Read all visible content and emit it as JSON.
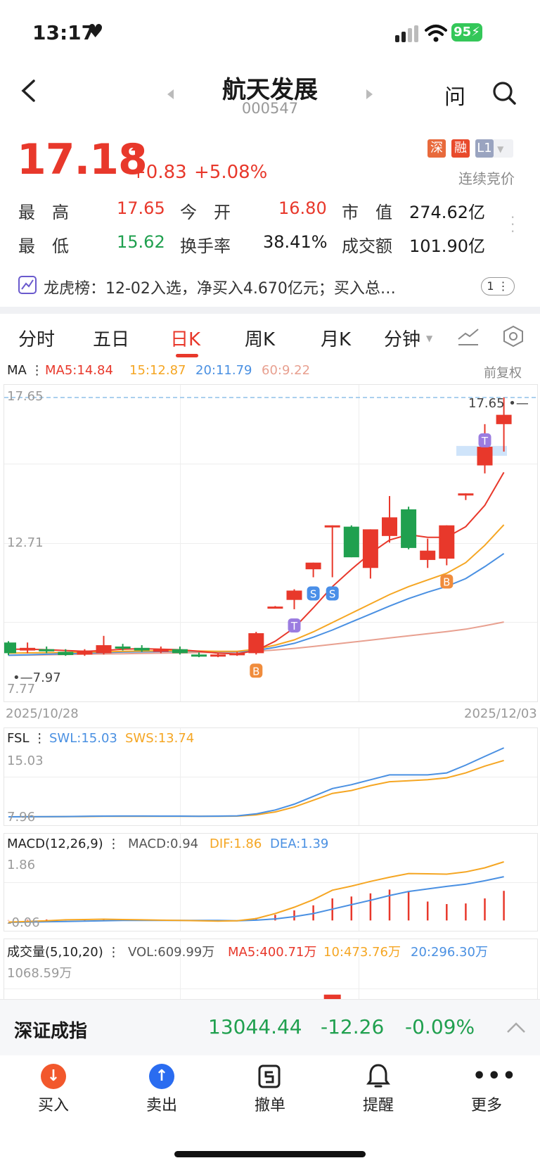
{
  "status_bar": {
    "time": "13:17",
    "battery": "95"
  },
  "header": {
    "title": "航天发展",
    "code": "000547",
    "ask_label": "问"
  },
  "quote": {
    "price": "17.18",
    "change": "+0.83",
    "change_pct": "+5.08%",
    "badges": [
      "深",
      "融",
      "L1"
    ],
    "trade_status": "连续竞价",
    "stats": [
      {
        "label": "最　高",
        "value": "17.65"
      },
      {
        "label": "今　开",
        "value": "16.80"
      },
      {
        "label": "市　值",
        "value": "274.62亿"
      },
      {
        "label": "最　低",
        "value": "15.62"
      },
      {
        "label": "换手率",
        "value": "38.41%"
      },
      {
        "label": "成交额",
        "value": "101.90亿"
      }
    ]
  },
  "notice": {
    "text": "龙虎榜：12-02入选，净买入4.670亿元；买入总…",
    "count": "1"
  },
  "tabs": [
    "分时",
    "五日",
    "日K",
    "周K",
    "月K",
    "分钟"
  ],
  "active_tab": "日K",
  "ma_legend": {
    "title": "MA",
    "ma5": "MA5:14.84",
    "ma15": "15:12.87",
    "ma20": "20:11.79",
    "ma60": "60:9.22",
    "adjust": "前复权"
  },
  "kline": {
    "y_top": "17.65",
    "y_mid": "12.71",
    "y_bottom": "7.77",
    "high_marker": "17.65",
    "low_marker": "7.97",
    "date_start": "2025/10/28",
    "date_end": "2025/12/03"
  },
  "fsl": {
    "title": "FSL",
    "swl": "SWL:15.03",
    "sws": "SWS:13.74",
    "y_top": "15.03",
    "y_bottom": "7.96"
  },
  "macd": {
    "title": "MACD(12,26,9)",
    "macd": "MACD:0.94",
    "dif": "DIF:1.86",
    "dea": "DEA:1.39",
    "y_top": "1.86",
    "y_bottom": "-0.06"
  },
  "volume": {
    "title": "成交量(5,10,20)",
    "vol": "VOL:609.99万",
    "ma5": "MA5:400.71万",
    "ma10": "10:473.76万",
    "ma20": "20:296.30万",
    "y_top": "1068.59万"
  },
  "index_bar": {
    "name": "深证成指",
    "value": "13044.44",
    "change": "-12.26",
    "change_pct": "-0.09%"
  },
  "bottom_nav": [
    "买入",
    "卖出",
    "撤单",
    "提醒",
    "更多"
  ],
  "colors": {
    "up": "#e8382b",
    "down": "#20a04f",
    "ma5": "#e8382b",
    "ma15": "#f5a623",
    "ma20": "#4a90e2",
    "ma60": "#e8a090"
  },
  "chart_data": {
    "type": "candlestick",
    "ylim": [
      7.77,
      17.65
    ],
    "candles": [
      {
        "o": 8.45,
        "c": 8.05,
        "h": 8.5,
        "l": 7.97
      },
      {
        "o": 8.15,
        "c": 8.25,
        "h": 8.45,
        "l": 8.05
      },
      {
        "o": 8.2,
        "c": 8.15,
        "h": 8.3,
        "l": 8.05
      },
      {
        "o": 8.1,
        "c": 7.98,
        "h": 8.2,
        "l": 7.95
      },
      {
        "o": 8.0,
        "c": 8.15,
        "h": 8.2,
        "l": 7.95
      },
      {
        "o": 8.05,
        "c": 8.35,
        "h": 8.7,
        "l": 8.0
      },
      {
        "o": 8.3,
        "c": 8.25,
        "h": 8.4,
        "l": 8.15
      },
      {
        "o": 8.25,
        "c": 8.15,
        "h": 8.35,
        "l": 8.1
      },
      {
        "o": 8.1,
        "c": 8.2,
        "h": 8.3,
        "l": 8.05
      },
      {
        "o": 8.2,
        "c": 8.05,
        "h": 8.3,
        "l": 8.0
      },
      {
        "o": 8.0,
        "c": 7.95,
        "h": 8.08,
        "l": 7.9
      },
      {
        "o": 7.97,
        "c": 8.0,
        "h": 8.05,
        "l": 7.9
      },
      {
        "o": 8.0,
        "c": 8.05,
        "h": 8.1,
        "l": 7.95
      },
      {
        "o": 8.05,
        "c": 8.8,
        "h": 8.85,
        "l": 8.0
      },
      {
        "o": 9.75,
        "c": 9.8,
        "h": 9.82,
        "l": 9.75
      },
      {
        "o": 10.05,
        "c": 10.4,
        "h": 10.45,
        "l": 9.7
      },
      {
        "o": 11.2,
        "c": 11.45,
        "h": 11.45,
        "l": 10.9
      },
      {
        "o": 12.8,
        "c": 12.85,
        "h": 12.85,
        "l": 10.9
      },
      {
        "o": 12.8,
        "c": 11.65,
        "h": 12.85,
        "l": 11.65
      },
      {
        "o": 11.25,
        "c": 12.7,
        "h": 12.7,
        "l": 10.85
      },
      {
        "o": 12.45,
        "c": 13.15,
        "h": 13.95,
        "l": 12.2
      },
      {
        "o": 13.45,
        "c": 12.0,
        "h": 13.55,
        "l": 11.95
      },
      {
        "o": 11.55,
        "c": 11.9,
        "h": 12.35,
        "l": 11.25
      },
      {
        "o": 11.6,
        "c": 12.85,
        "h": 12.85,
        "l": 11.35
      },
      {
        "o": 14.0,
        "c": 14.05,
        "h": 14.05,
        "l": 13.8
      },
      {
        "o": 15.1,
        "c": 15.8,
        "h": 16.65,
        "l": 14.8
      },
      {
        "o": 16.65,
        "c": 17.0,
        "h": 17.65,
        "l": 15.62
      }
    ],
    "ma5": [
      8.2,
      8.2,
      8.18,
      8.15,
      8.12,
      8.15,
      8.2,
      8.22,
      8.2,
      8.18,
      8.12,
      8.05,
      8.02,
      8.15,
      8.5,
      9.0,
      9.75,
      10.55,
      11.2,
      11.8,
      12.3,
      12.5,
      12.4,
      12.4,
      12.8,
      13.6,
      14.84
    ],
    "ma15": [
      8.05,
      8.06,
      8.07,
      8.08,
      8.09,
      8.1,
      8.12,
      8.13,
      8.14,
      8.14,
      8.13,
      8.12,
      8.12,
      8.2,
      8.35,
      8.55,
      8.85,
      9.2,
      9.55,
      9.9,
      10.25,
      10.55,
      10.8,
      11.05,
      11.45,
      12.1,
      12.87
    ],
    "ma20": [
      7.97,
      7.99,
      8.01,
      8.03,
      8.05,
      8.07,
      8.09,
      8.1,
      8.11,
      8.12,
      8.12,
      8.11,
      8.1,
      8.15,
      8.27,
      8.42,
      8.65,
      8.92,
      9.22,
      9.52,
      9.82,
      10.1,
      10.34,
      10.56,
      10.85,
      11.3,
      11.79
    ],
    "ma60": [
      7.97,
      7.98,
      7.99,
      8.0,
      8.01,
      8.02,
      8.03,
      8.04,
      8.05,
      8.06,
      8.07,
      8.08,
      8.09,
      8.12,
      8.17,
      8.23,
      8.3,
      8.38,
      8.46,
      8.54,
      8.62,
      8.7,
      8.78,
      8.86,
      8.95,
      9.08,
      9.22
    ],
    "signals": [
      {
        "i": 13,
        "label": "B",
        "pos": "below"
      },
      {
        "i": 15,
        "label": "T",
        "pos": "below"
      },
      {
        "i": 16,
        "label": "S",
        "pos": "below"
      },
      {
        "i": 17,
        "label": "S",
        "pos": "below"
      },
      {
        "i": 23,
        "label": "B",
        "pos": "below"
      },
      {
        "i": 25,
        "label": "T",
        "pos": "above"
      }
    ],
    "fsl_ylim": [
      7.96,
      15.03
    ],
    "swl": [
      7.96,
      7.97,
      7.98,
      7.99,
      8.02,
      8.03,
      8.04,
      8.04,
      8.03,
      8.03,
      8.02,
      8.03,
      8.06,
      8.26,
      8.66,
      9.26,
      10.06,
      10.86,
      11.26,
      11.76,
      12.26,
      12.26,
      12.26,
      12.46,
      13.26,
      14.16,
      15.03
    ],
    "sws": [
      7.96,
      7.97,
      7.97,
      7.98,
      7.99,
      8.01,
      8.02,
      8.02,
      8.02,
      8.02,
      8.02,
      8.02,
      8.03,
      8.16,
      8.46,
      8.96,
      9.66,
      10.36,
      10.66,
      11.16,
      11.56,
      11.66,
      11.76,
      11.96,
      12.46,
      13.16,
      13.74
    ],
    "macd_ylim": [
      -0.06,
      1.86
    ],
    "dif": [
      -0.05,
      -0.03,
      -0.01,
      0.02,
      0.03,
      0.04,
      0.03,
      0.02,
      0.01,
      0.0,
      -0.01,
      -0.02,
      -0.01,
      0.06,
      0.22,
      0.42,
      0.66,
      0.96,
      1.09,
      1.24,
      1.37,
      1.49,
      1.48,
      1.47,
      1.54,
      1.67,
      1.86
    ],
    "dea": [
      -0.06,
      -0.05,
      -0.04,
      -0.03,
      -0.02,
      -0.01,
      0.0,
      0.0,
      0.0,
      0.0,
      0.0,
      0.0,
      -0.01,
      0.01,
      0.05,
      0.12,
      0.22,
      0.36,
      0.5,
      0.64,
      0.79,
      0.92,
      1.0,
      1.08,
      1.15,
      1.26,
      1.39
    ],
    "macd_hist": [
      0.01,
      0.02,
      0.03,
      0.04,
      0.04,
      0.04,
      0.03,
      0.02,
      0.01,
      0.0,
      -0.01,
      -0.02,
      0.0,
      0.08,
      0.18,
      0.32,
      0.48,
      0.7,
      0.76,
      0.86,
      0.98,
      0.9,
      0.6,
      0.52,
      0.54,
      0.7,
      0.94
    ],
    "volume_ylim": [
      0,
      1068.59
    ],
    "volume_visible": [
      {
        "i": 17,
        "v": 980,
        "up": true
      },
      {
        "i": 19,
        "v": 740,
        "up": true
      },
      {
        "i": 20,
        "v": 880,
        "up": true
      },
      {
        "i": 26,
        "v": 609.99,
        "up": true
      }
    ]
  }
}
